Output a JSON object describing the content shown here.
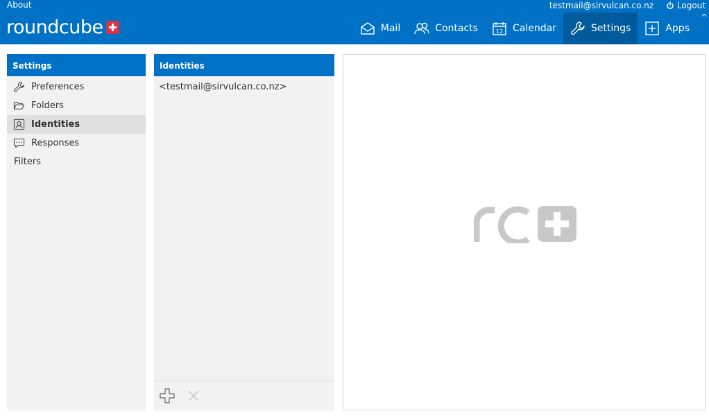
{
  "topbar": {
    "about": "About",
    "user_email": "testmail@sirvulcan.co.nz",
    "logout": "Logout",
    "logo_text": "roundcube"
  },
  "nav": {
    "items": [
      {
        "label": "Mail",
        "icon": "envelope-icon"
      },
      {
        "label": "Contacts",
        "icon": "contacts-icon"
      },
      {
        "label": "Calendar",
        "icon": "calendar-icon"
      },
      {
        "label": "Settings",
        "icon": "wrench-icon",
        "active": true
      },
      {
        "label": "Apps",
        "icon": "plus-square-icon"
      }
    ],
    "calendar_day": "12"
  },
  "settings": {
    "title": "Settings",
    "items": [
      {
        "label": "Preferences",
        "icon": "wrench-icon"
      },
      {
        "label": "Folders",
        "icon": "folder-open-icon"
      },
      {
        "label": "Identities",
        "icon": "id-card-icon",
        "selected": true
      },
      {
        "label": "Responses",
        "icon": "chat-icon"
      },
      {
        "label": "Filters"
      }
    ]
  },
  "identities": {
    "title": "Identities",
    "items": [
      {
        "label": "<testmail@sirvulcan.co.nz>"
      }
    ]
  },
  "colors": {
    "brand_blue": "#0071c5",
    "active_nav": "#005a9c",
    "logo_red": "#d9334a",
    "panel_bg": "#f2f2f2",
    "watermark_gray": "#c8c8c8"
  }
}
